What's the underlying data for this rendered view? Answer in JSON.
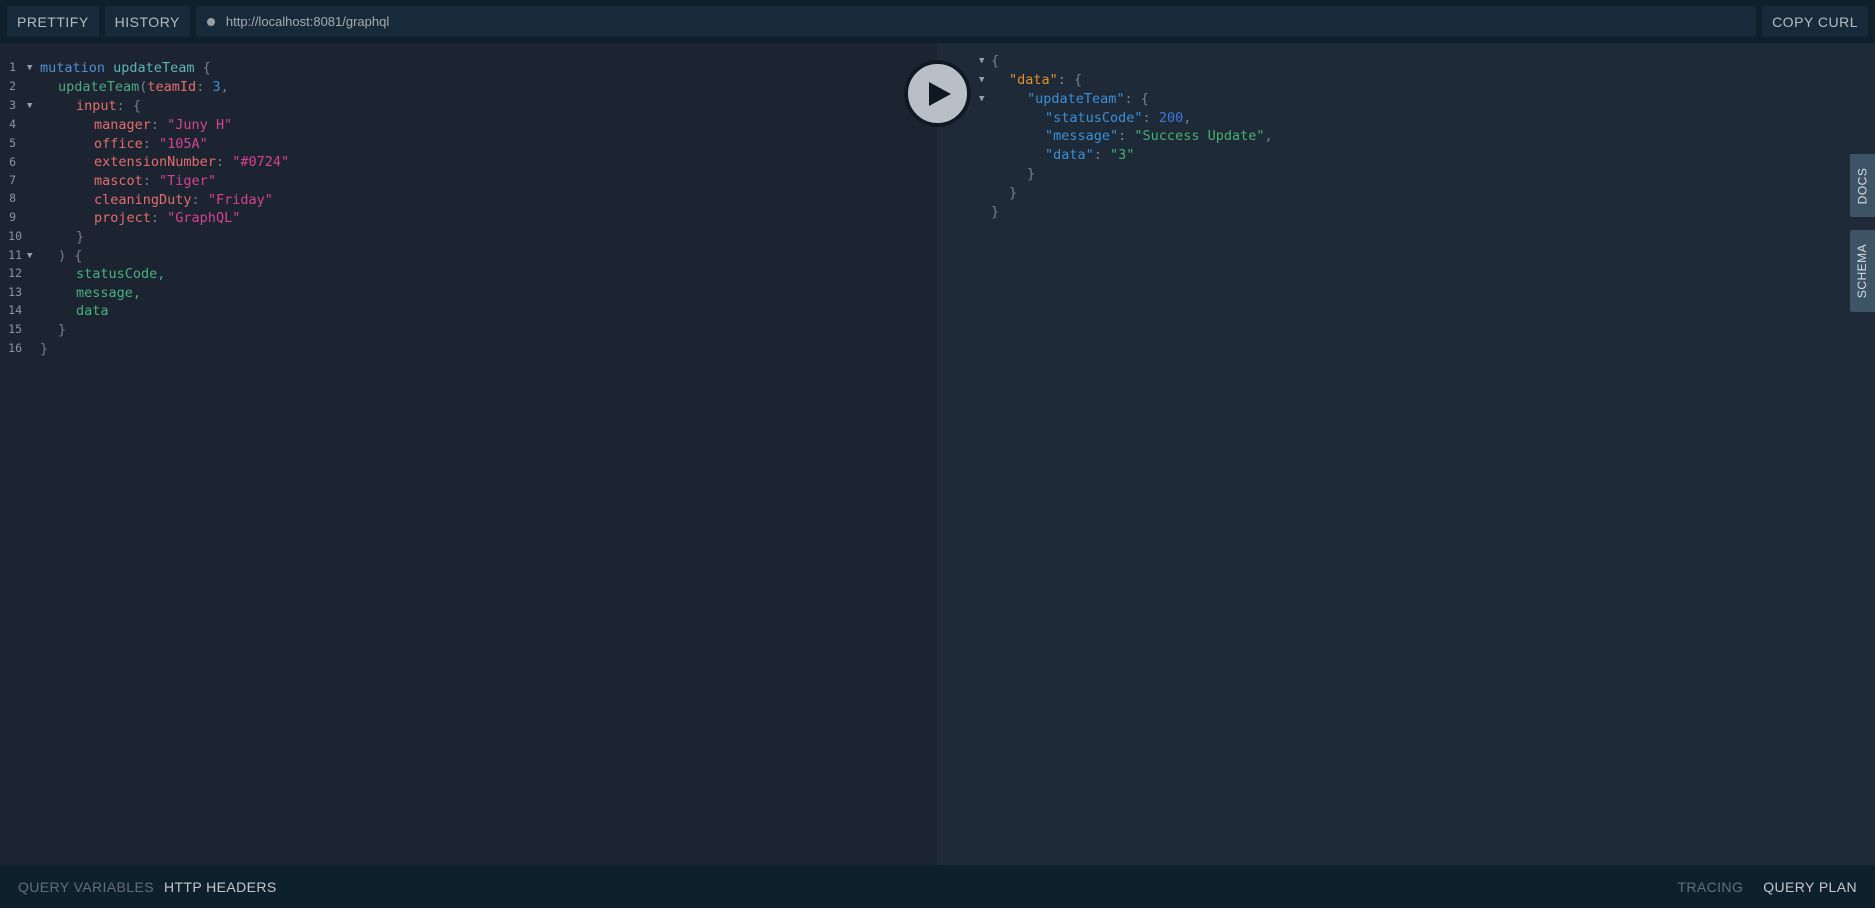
{
  "toolbar": {
    "prettify_label": "PRETTIFY",
    "history_label": "HISTORY",
    "url": "http://localhost:8081/graphql",
    "copy_curl_label": "COPY CURL"
  },
  "editor": {
    "line_numbers": [
      "1",
      "2",
      "3",
      "4",
      "5",
      "6",
      "7",
      "8",
      "9",
      "10",
      "11",
      "12",
      "13",
      "14",
      "15",
      "16"
    ],
    "query": {
      "l1_kw": "mutation",
      "l1_name": "updateTeam",
      "l1_brace": "{",
      "l2_fn": "updateTeam",
      "l2_paren": "(",
      "l2_arg": "teamId",
      "l2_colon": ":",
      "l2_val": "3",
      "l2_comma": ",",
      "l3_arg": "input",
      "l3_rest": ": {",
      "args": [
        {
          "key": "manager",
          "value": "\"Juny H\""
        },
        {
          "key": "office",
          "value": "\"105A\""
        },
        {
          "key": "extensionNumber",
          "value": "\"#0724\""
        },
        {
          "key": "mascot",
          "value": "\"Tiger\""
        },
        {
          "key": "cleaningDuty",
          "value": "\"Friday\""
        },
        {
          "key": "project",
          "value": "\"GraphQL\""
        }
      ],
      "l10": "}",
      "l11": ") {",
      "fields": [
        "statusCode,",
        "message,",
        "data"
      ],
      "l15": "}",
      "l16": "}"
    }
  },
  "result": {
    "open_brace": "{",
    "data_key": "\"data\"",
    "data_rest": ": {",
    "update_key": "\"updateTeam\"",
    "update_rest": ": {",
    "status_key": "\"statusCode\"",
    "status_val": "200",
    "message_key": "\"message\"",
    "message_val": "\"Success Update\"",
    "data2_key": "\"data\"",
    "data2_val": "\"3\"",
    "close1": "}",
    "close2": "}",
    "close3": "}"
  },
  "side_tabs": {
    "docs": "DOCS",
    "schema": "SCHEMA"
  },
  "bottombar": {
    "query_variables": "QUERY VARIABLES",
    "http_headers": "HTTP HEADERS",
    "tracing": "TRACING",
    "query_plan": "QUERY PLAN"
  },
  "colors": {
    "background": "#172a3a",
    "editor_bg": "#1b2430",
    "result_bg": "#1e2a37",
    "string": "#d64292",
    "keyword": "#4f8fd2",
    "field": "#48b27c",
    "argument": "#e56c6c"
  }
}
